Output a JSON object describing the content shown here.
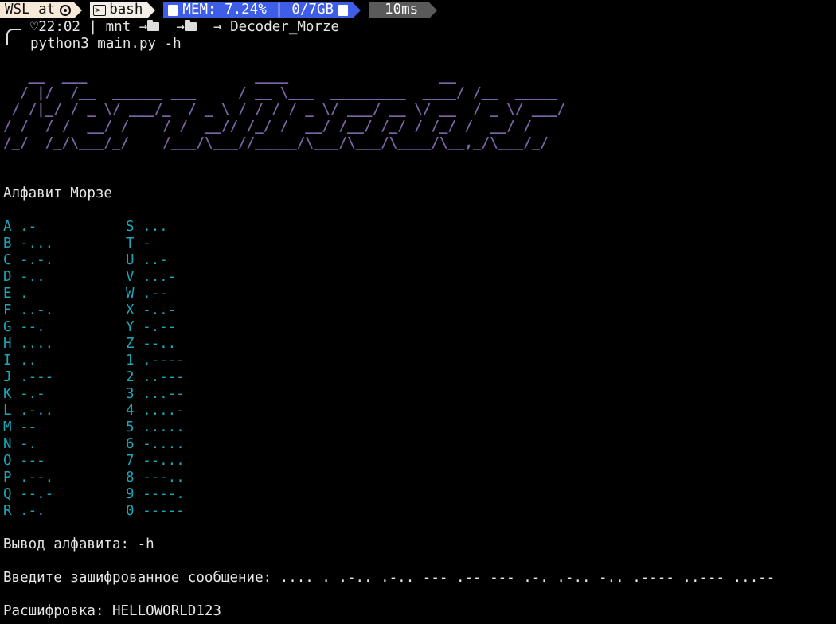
{
  "prompt": {
    "wsl_label": "WSL at",
    "shell_label": "bash",
    "mem_label": "MEM: 7.24% | 0/7GB",
    "duration_label": "10ms",
    "time": "22:02",
    "separator": "|",
    "path_root": "mnt",
    "path_last": "Decoder_Morze",
    "command": "python3 main.py -h",
    "colors": {
      "wsl_bg": "#f7e9d7",
      "mem_bg": "#3f5ee8",
      "time_bg": "#5a5a5a"
    }
  },
  "banner": {
    "ascii": "   __  ___                    ____                  __       \n  / |/  /__  ______ ___     / __ \\___  _________  ____/ /__  _____\n / /|_/ / _ \\/ ___/_  / _ \\ / / / / _ \\/ ___/ __ \\/ __  / _ \\/ ___/\n/ /  / /  __/ /    / /  __// /_/ /  __/ /__/ /_/ / /_/ /  __/ /    \n/_/  /_/\\___/_/    /___/\\___//_____/\\___/\\___/\\____/\\__,_/\\___/_/     ",
    "color": "#7d65a8"
  },
  "alphabet": {
    "title": "Алфавит Морзе",
    "left": [
      "A .-",
      "B -...",
      "C -.-.",
      "D -..",
      "E .",
      "F ..-.",
      "G --.",
      "H ....",
      "I ..",
      "J .---",
      "K -.-",
      "L .-..",
      "M --",
      "N -.",
      "O ---",
      "P .--.",
      "Q --.-",
      "R .-."
    ],
    "right": [
      "S ...",
      "T -",
      "U ..-",
      "V ...-",
      "W .--",
      "X -..-",
      "Y -.--",
      "Z --..",
      "1 .----",
      "2 ..---",
      "3 ...--",
      "4 ....-",
      "5 .....",
      "6 -....",
      "7 --...",
      "8 ---..",
      "9 ----.",
      "0 -----"
    ],
    "color": "#1aa7b8"
  },
  "output": {
    "alphabet_flag_line": "Вывод алфавита: -h",
    "input_line": "Введите зашифрованное сообщение: .... . .-.. .-.. --- .-- --- .-. .-.. -.. .---- ..--- ...--",
    "decoded_line": "Расшифровка: HELLOWORLD123"
  }
}
